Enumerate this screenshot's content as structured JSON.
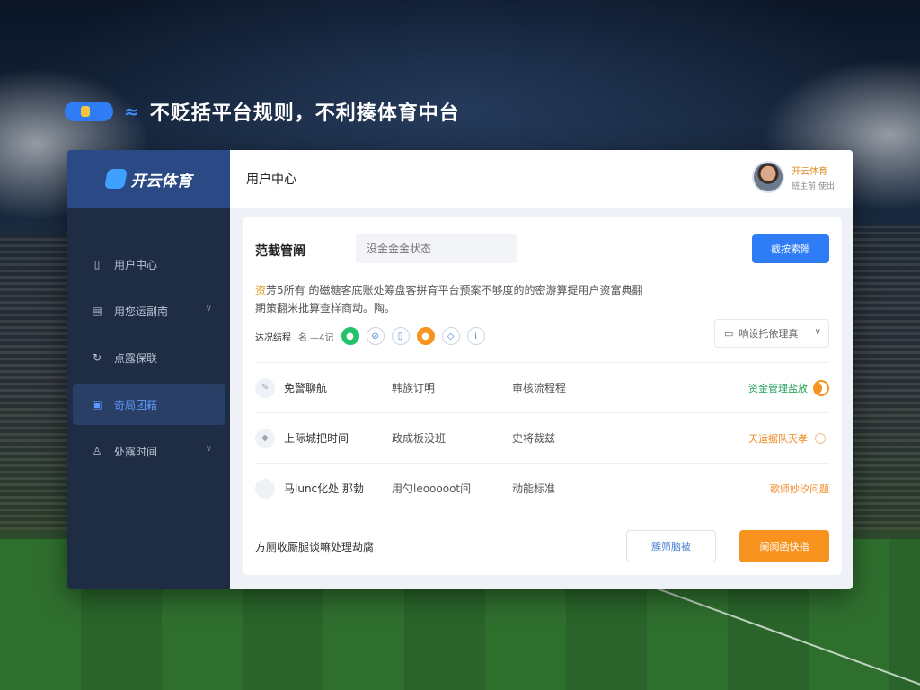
{
  "banner": {
    "title": "不贬括平台规则，不利揍体育中台"
  },
  "brand": {
    "name": "开云体育",
    "accent": "#2f7df6",
    "warning": "#f7931e",
    "success": "#22c26a"
  },
  "sidebar": {
    "items": [
      {
        "label": "用户中心",
        "icon": "document-icon",
        "has_chevron": false,
        "active": false
      },
      {
        "label": "用您运副南",
        "icon": "calendar-icon",
        "has_chevron": true,
        "active": false
      },
      {
        "label": "点露保联",
        "icon": "refresh-icon",
        "has_chevron": false,
        "active": false
      },
      {
        "label": "奇局团藉",
        "icon": "folder-icon",
        "has_chevron": false,
        "active": true
      },
      {
        "label": "处露时间",
        "icon": "user-icon",
        "has_chevron": true,
        "active": false
      }
    ]
  },
  "header": {
    "breadcrumb": "用户中心",
    "user_name": "开云体育",
    "user_role": "班主前 使出"
  },
  "card": {
    "title": "范截管阐",
    "search_placeholder": "没金金金状态",
    "primary_button": "截按索隙",
    "desc_highlight": "资",
    "desc_rest": "芳5所有 的磁糖客底账处筹盘客拼育平台预案不够度的的密游算提用户资富典翻",
    "desc_line2": "期策翻米批算查样商动。陶。",
    "filter_label": "达况结程",
    "filter_range": "名 —4记",
    "select_label": "响设托依理真"
  },
  "rows": [
    {
      "name": "免警聊航",
      "col2": "韩族订明",
      "col3": "审核流程程",
      "status": "资金管理盐放",
      "status_color": "green",
      "toggle": "on"
    },
    {
      "name": "上际城把时间",
      "col2": "政成板没班",
      "col3": "史将裁兹",
      "status": "天运据队灭孝",
      "status_color": "orange",
      "toggle": "off"
    },
    {
      "name": "马lunc化处 那勃",
      "col2": "用勺leooooot间",
      "col3": "动能标准",
      "status": "歌师妙汐问题",
      "status_color": "orange",
      "toggle": "none"
    }
  ],
  "footer": {
    "note": "方厕收厮腿谈嘛处理劫腐",
    "ghost_button": "簇筛脑被",
    "orange_button": "阑阂函快指"
  }
}
